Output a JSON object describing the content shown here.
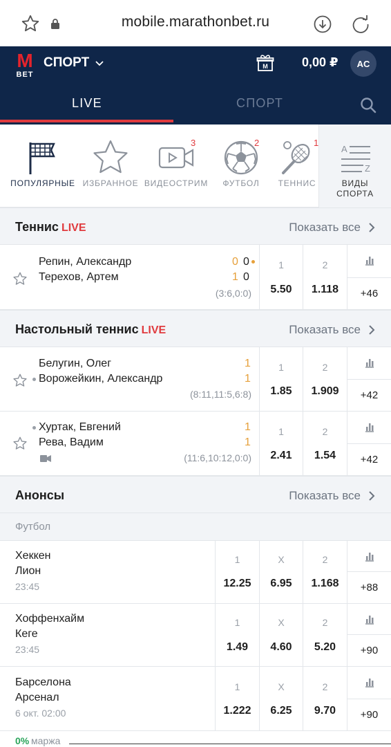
{
  "browser": {
    "url": "mobile.marathonbet.ru"
  },
  "header": {
    "logo_top": "M",
    "logo_bottom": "BET",
    "sport_select": "СПОРТ",
    "balance": "0,00 ₽",
    "avatar": "AC",
    "tabs": [
      {
        "label": "LIVE"
      },
      {
        "label": "СПОРТ"
      }
    ]
  },
  "sports": [
    {
      "label": "ПОПУЛЯРНЫЕ",
      "icon": "flag-icon",
      "badge": ""
    },
    {
      "label": "ИЗБРАННОЕ",
      "icon": "star-icon",
      "badge": ""
    },
    {
      "label": "ВИДЕОСТРИМ",
      "icon": "video-icon",
      "badge": "3"
    },
    {
      "label": "ФУТБОЛ",
      "icon": "soccer-ball-icon",
      "badge": "2"
    },
    {
      "label": "ТЕННИС",
      "icon": "tennis-icon",
      "badge": "1"
    },
    {
      "label_line1": "ВИДЫ",
      "label_line2": "СПОРТА",
      "icon": "sort-az-icon"
    }
  ],
  "sections": {
    "tennis": {
      "title": "Теннис",
      "live": "LIVE",
      "show_all": "Показать все",
      "events": [
        {
          "team1": "Репин, Александр",
          "team2": "Терехов, Артем",
          "score1_a": "0",
          "score1_b": "0",
          "score2_a": "1",
          "score2_b": "0",
          "period": "(3:6,0:0)",
          "odd1_label": "1",
          "odd1": "5.50",
          "odd2_label": "2",
          "odd2": "1.118",
          "more": "+46"
        }
      ]
    },
    "table_tennis": {
      "title": "Настольный теннис",
      "live": "LIVE",
      "show_all": "Показать все",
      "events": [
        {
          "team1": "Белугин, Олег",
          "team2": "Ворожейкин, Александр",
          "score1": "1",
          "score2": "1",
          "period": "(8:11,11:5,6:8)",
          "odd1_label": "1",
          "odd1": "1.85",
          "odd2_label": "2",
          "odd2": "1.909",
          "more": "+42"
        },
        {
          "team1": "Хуртак, Евгений",
          "team2": "Рева, Вадим",
          "score1": "1",
          "score2": "1",
          "period": "(11:6,10:12,0:0)",
          "odd1_label": "1",
          "odd1": "2.41",
          "odd2_label": "2",
          "odd2": "1.54",
          "more": "+42"
        }
      ]
    },
    "announcements": {
      "title": "Анонсы",
      "show_all": "Показать все",
      "sub": "Футбол",
      "events": [
        {
          "team1": "Хеккен",
          "team2": "Лион",
          "time": "23:45",
          "l1": "1",
          "o1": "12.25",
          "lx": "X",
          "ox": "6.95",
          "l2": "2",
          "o2": "1.168",
          "more": "+88"
        },
        {
          "team1": "Хоффенхайм",
          "team2": "Кеге",
          "time": "23:45",
          "l1": "1",
          "o1": "1.49",
          "lx": "X",
          "ox": "4.60",
          "l2": "2",
          "o2": "5.20",
          "more": "+90"
        },
        {
          "team1": "Барселона",
          "team2": "Арсенал",
          "time": "6 окт. 02:00",
          "l1": "1",
          "o1": "1.222",
          "lx": "X",
          "ox": "6.25",
          "l2": "2",
          "o2": "9.70",
          "more": "+90"
        }
      ]
    }
  },
  "footer": {
    "margin_pct": "0%",
    "margin_label": "маржа"
  },
  "colors": {
    "header_bg": "#0f2649",
    "accent_red": "#e03a3e",
    "score_orange": "#e6a03a",
    "margin_green": "#2ca55c"
  }
}
